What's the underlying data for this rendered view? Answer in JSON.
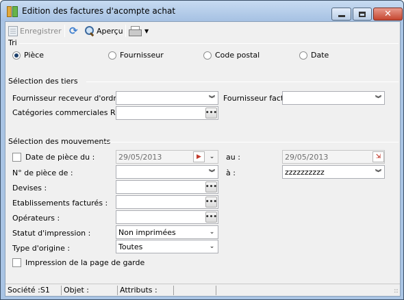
{
  "window": {
    "title": "Edition des factures d'acompte achat",
    "close_glyph": "✕"
  },
  "toolbar": {
    "save_label": "Enregistrer",
    "preview_label": "Aperçu",
    "icons": [
      "save-icon",
      "refresh-icon",
      "magnifier-icon",
      "printer-icon",
      "dropdown-caret-icon"
    ]
  },
  "tri": {
    "title": "Tri",
    "options": [
      "Pièce",
      "Fournisseur",
      "Code postal",
      "Date"
    ],
    "selected": "Pièce"
  },
  "tiers": {
    "title": "Sélection des tiers",
    "fournisseur_receveur_label": "Fournisseur receveur d'ordres :",
    "fournisseur_receveur_value": "",
    "fournisseur_fact_label": "Fournisseur fact. :",
    "fournisseur_fact_value": "",
    "categories_label": "Catégories commerciales RO :",
    "categories_value": ""
  },
  "mouvements": {
    "title": "Sélection des mouvements",
    "date_label": "Date de pièce du :",
    "date_from": "29/05/2013",
    "date_to_label": "au :",
    "date_to": "29/05/2013",
    "num_label": "N° de pièce de :",
    "num_from": "",
    "num_to_label": "à :",
    "num_to": "zzzzzzzzzz",
    "devises_label": "Devises :",
    "devises_value": "",
    "etablissements_label": "Etablissements facturés :",
    "etablissements_value": "",
    "operateurs_label": "Opérateurs :",
    "operateurs_value": "",
    "statut_label": "Statut d'impression :",
    "statut_value": "Non imprimées",
    "type_label": "Type d'origine :",
    "type_value": "Toutes",
    "page_garde_label": "Impression de la page de garde"
  },
  "status": {
    "societe": "Société :S1",
    "objet": "Objet :",
    "attributs": "Attributs :",
    "grip": ":::"
  },
  "glyphs": {
    "dots": "•••",
    "chevron": "⌄",
    "double_chevron": "︾",
    "dropdown": "▼",
    "calendar": "⇲",
    "arrow": "▶"
  }
}
